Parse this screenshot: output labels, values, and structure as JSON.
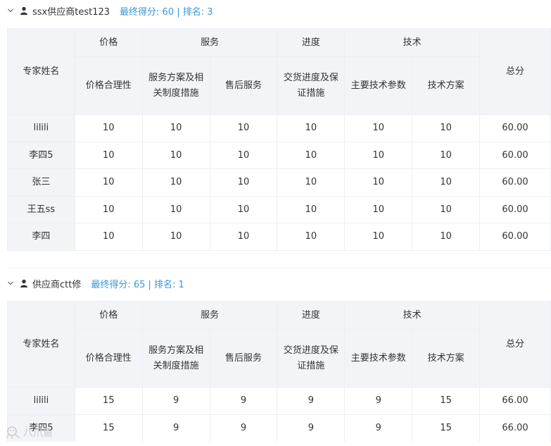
{
  "sections": [
    {
      "supplier": "ssx供应商test123",
      "score_info": "最终得分: 60 | 排名: 3",
      "header": {
        "expert_name": "专家姓名",
        "group_price": "价格",
        "group_service": "服务",
        "group_progress": "进度",
        "group_tech": "技术",
        "total": "总分",
        "sub": [
          "价格合理性",
          "服务方案及相关制度措施",
          "售后服务",
          "交货进度及保证措施",
          "主要技术参数",
          "技术方案"
        ]
      },
      "rows": [
        {
          "name": "lilili",
          "c": [
            "10",
            "10",
            "10",
            "10",
            "10",
            "10"
          ],
          "total": "60.00"
        },
        {
          "name": "李四5",
          "c": [
            "10",
            "10",
            "10",
            "10",
            "10",
            "10"
          ],
          "total": "60.00"
        },
        {
          "name": "张三",
          "c": [
            "10",
            "10",
            "10",
            "10",
            "10",
            "10"
          ],
          "total": "60.00"
        },
        {
          "name": "王五ss",
          "c": [
            "10",
            "10",
            "10",
            "10",
            "10",
            "10"
          ],
          "total": "60.00"
        },
        {
          "name": "李四",
          "c": [
            "10",
            "10",
            "10",
            "10",
            "10",
            "10"
          ],
          "total": "60.00"
        }
      ]
    },
    {
      "supplier": "供应商ctt修",
      "score_info": "最终得分: 65 | 排名: 1",
      "header": {
        "expert_name": "专家姓名",
        "group_price": "价格",
        "group_service": "服务",
        "group_progress": "进度",
        "group_tech": "技术",
        "total": "总分",
        "sub": [
          "价格合理性",
          "服务方案及相关制度措施",
          "售后服务",
          "交货进度及保证措施",
          "主要技术参数",
          "技术方案"
        ]
      },
      "rows": [
        {
          "name": "lilili",
          "c": [
            "15",
            "9",
            "9",
            "9",
            "9",
            "15"
          ],
          "total": "66.00"
        },
        {
          "name": "李四5",
          "c": [
            "15",
            "9",
            "9",
            "9",
            "9",
            "15"
          ],
          "total": "66.00"
        }
      ]
    }
  ],
  "watermark": "八爪鱼"
}
